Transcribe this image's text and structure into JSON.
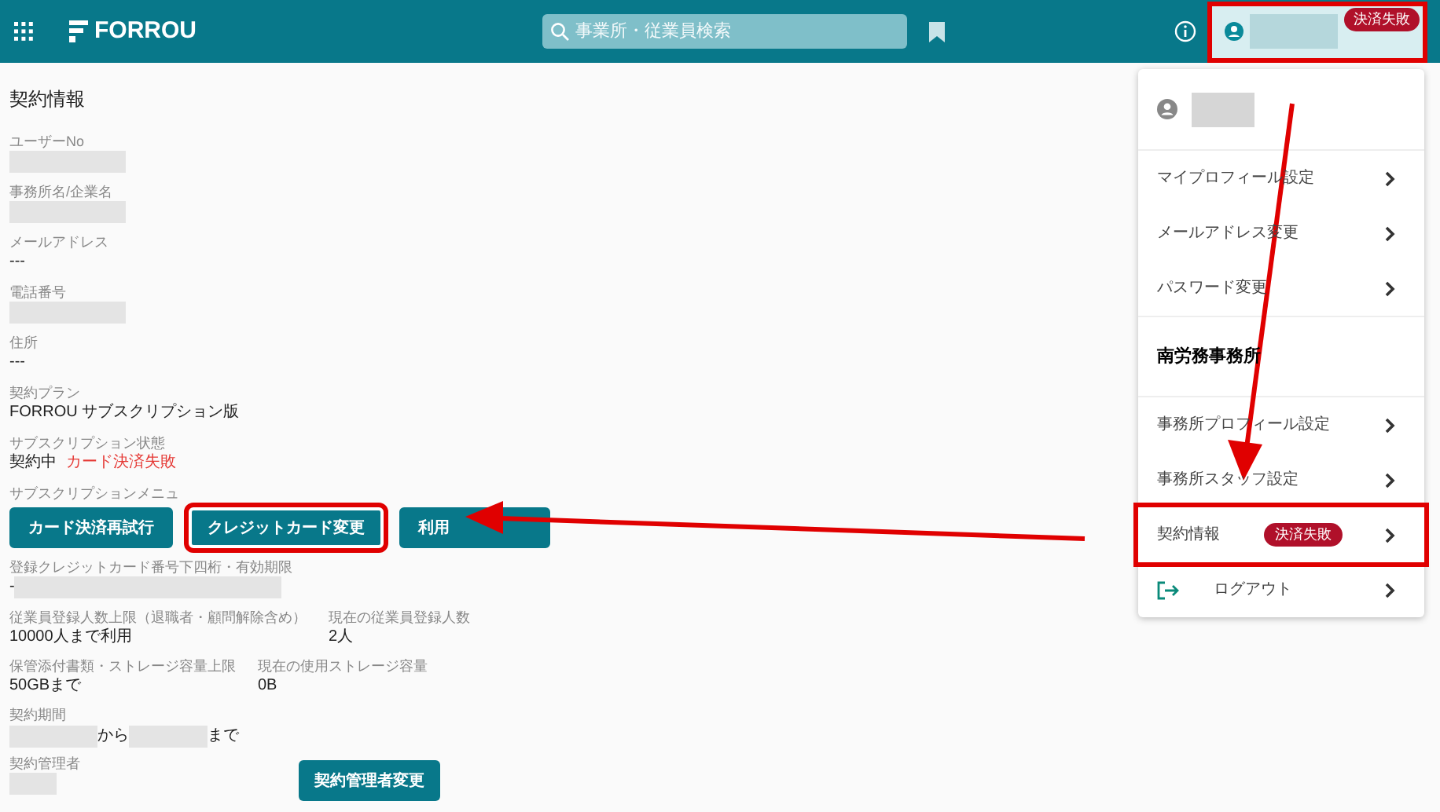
{
  "header": {
    "logo": "FORROU",
    "search_placeholder": "事業所・従業員検索",
    "user_badge": "決済失敗",
    "highlighted": true
  },
  "page_title": "契約情報",
  "fields": [
    {
      "label": "ユーザーNo",
      "kind": "redacted"
    },
    {
      "label": "事務所名/企業名",
      "kind": "redacted"
    },
    {
      "label": "メールアドレス",
      "kind": "text",
      "value": "---"
    },
    {
      "label": "電話番号",
      "kind": "redacted"
    },
    {
      "label": "住所",
      "kind": "text",
      "value": "---"
    },
    {
      "label": "契約プラン",
      "kind": "text",
      "value": "FORROU サブスクリプション版"
    },
    {
      "label": "サブスクリプション状態",
      "kind": "status",
      "value": "契約中",
      "alert": "カード決済失敗"
    }
  ],
  "subscription_menu": {
    "label": "サブスクリプションメニュ",
    "buttons": [
      {
        "label": "カード決済再試行",
        "highlighted": false
      },
      {
        "label": "クレジットカード変更",
        "highlighted": true
      },
      {
        "label": "利用",
        "highlighted": false
      }
    ]
  },
  "card": {
    "label": "登録クレジットカード番号下四桁・有効期限",
    "value": "-"
  },
  "pairs": [
    [
      {
        "label": "従業員登録人数上限（退職者・顧問解除含め）",
        "value": "10000人まで利用"
      },
      {
        "label": "現在の従業員登録人数",
        "value": "2人"
      }
    ],
    [
      {
        "label": "保管添付書類・ストレージ容量上限",
        "value": "50GBまで"
      },
      {
        "label": "現在の使用ストレージ容量",
        "value": "0B"
      }
    ]
  ],
  "period": {
    "label": "契約期間",
    "from": "から",
    "to": "まで"
  },
  "manager": {
    "label": "契約管理者",
    "button": "契約管理者変更"
  },
  "menu": {
    "groups": [
      {
        "items": [
          {
            "label": "マイプロフィール設定",
            "highlighted": false
          },
          {
            "label": "メールアドレス変更",
            "highlighted": false
          },
          {
            "label": "パスワード変更",
            "highlighted": false
          }
        ]
      },
      {
        "title": "南労務事務所",
        "items": [
          {
            "label": "事務所プロフィール設定",
            "highlighted": false
          },
          {
            "label": "事務所スタッフ設定",
            "highlighted": false
          },
          {
            "label": "契約情報",
            "badge": "決済失敗",
            "highlighted": true
          }
        ]
      }
    ],
    "logout": "ログアウト"
  }
}
